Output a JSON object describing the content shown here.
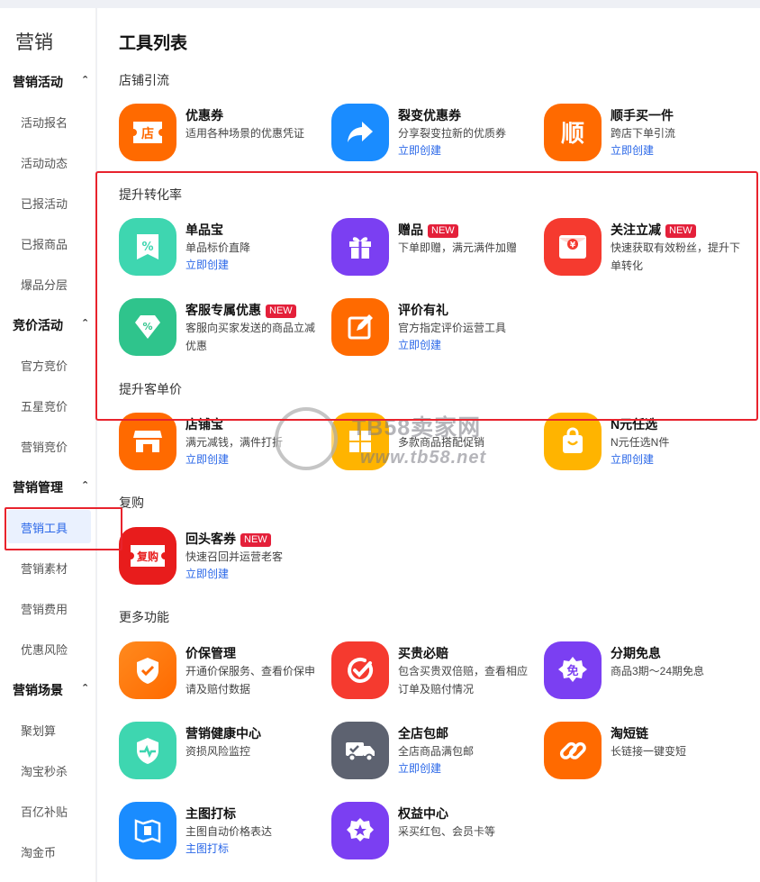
{
  "sidebar": {
    "title": "营销",
    "groups": [
      {
        "label": "营销活动",
        "items": [
          "活动报名",
          "活动动态",
          "已报活动",
          "已报商品",
          "爆品分层"
        ]
      },
      {
        "label": "竞价活动",
        "items": [
          "官方竞价",
          "五星竞价",
          "营销竞价"
        ]
      },
      {
        "label": "营销管理",
        "items": [
          "营销工具",
          "营销素材",
          "营销费用",
          "优惠风险"
        ]
      },
      {
        "label": "营销场景",
        "items": [
          "聚划算",
          "淘宝秒杀",
          "百亿补贴",
          "淘金币"
        ]
      }
    ],
    "active_item": "营销工具"
  },
  "main": {
    "title": "工具列表",
    "new_badge": "NEW",
    "create_link": "立即创建",
    "sections": [
      {
        "title": "店铺引流",
        "cards": [
          {
            "name": "优惠券",
            "desc": "适用各种场景的优惠凭证",
            "link": "",
            "icon": "shop-coupon-icon",
            "color": "#ff6a00",
            "icon_text": "店"
          },
          {
            "name": "裂变优惠券",
            "desc": "分享裂变拉新的优质券",
            "link": "立即创建",
            "icon": "share-arrow-icon",
            "color": "#1a8cff"
          },
          {
            "name": "顺手买一件",
            "desc": "跨店下单引流",
            "link": "立即创建",
            "icon": "shun-icon",
            "color": "#ff6a00",
            "icon_text": "顺"
          }
        ]
      },
      {
        "title": "提升转化率",
        "cards": [
          {
            "name": "单品宝",
            "desc": "单品标价直降",
            "link": "立即创建",
            "icon": "discount-tag-icon",
            "color": "#3ed6b0"
          },
          {
            "name": "赠品",
            "badge": "NEW",
            "desc": "下单即赠，满元满件加赠",
            "link": "",
            "icon": "gift-icon",
            "color": "#7b3ff2"
          },
          {
            "name": "关注立减",
            "badge": "NEW",
            "desc": "快速获取有效粉丝，提升下单转化",
            "link": "",
            "icon": "red-packet-icon",
            "color": "#f53a2f"
          },
          {
            "name": "客服专属优惠",
            "badge": "NEW",
            "desc": "客服向买家发送的商品立减优惠",
            "link": "",
            "icon": "service-discount-icon",
            "color": "#2fc48c"
          },
          {
            "name": "评价有礼",
            "desc": "官方指定评价运营工具",
            "link": "立即创建",
            "icon": "edit-review-icon",
            "color": "#ff6a00"
          }
        ]
      },
      {
        "title": "提升客单价",
        "cards": [
          {
            "name": "店铺宝",
            "desc": "满元减钱，满件打折",
            "link": "立即创建",
            "icon": "store-icon",
            "color": "#ff6a00"
          },
          {
            "name": "",
            "desc": "多款商品搭配促销",
            "link": "",
            "icon": "bundle-grid-icon",
            "color": "#ffb400"
          },
          {
            "name": "N元任选",
            "desc": "N元任选N件",
            "link": "立即创建",
            "icon": "shopping-bag-icon",
            "color": "#ffb400"
          }
        ]
      },
      {
        "title": "复购",
        "cards": [
          {
            "name": "回头客券",
            "badge": "NEW",
            "desc": "快速召回并运营老客",
            "link": "立即创建",
            "icon": "repurchase-coupon-icon",
            "color": "#e81c1c",
            "icon_text": "复购"
          }
        ]
      },
      {
        "title": "更多功能",
        "cards": [
          {
            "name": "价保管理",
            "desc": "开通价保服务、查看价保申请及赔付数据",
            "link": "",
            "icon": "price-shield-icon",
            "color": "#ff6a00"
          },
          {
            "name": "买贵必赔",
            "desc": "包含买贵双倍赔，查看相应订单及赔付情况",
            "link": "",
            "icon": "check-circle-icon",
            "color": "#f53a2f"
          },
          {
            "name": "分期免息",
            "desc": "商品3期～24期免息",
            "link": "",
            "icon": "interest-free-icon",
            "color": "#7b3ff2",
            "icon_text": "免"
          },
          {
            "name": "营销健康中心",
            "desc": "资损风险监控",
            "link": "",
            "icon": "health-shield-icon",
            "color": "#3ed6b0"
          },
          {
            "name": "全店包邮",
            "desc": "全店商品满包邮",
            "link": "立即创建",
            "icon": "delivery-truck-icon",
            "color": "#5d6270"
          },
          {
            "name": "淘短链",
            "desc": "长链接一键变短",
            "link": "",
            "icon": "link-icon",
            "color": "#ff6a00"
          },
          {
            "name": "主图打标",
            "desc": "主图自动价格表达",
            "link": "主图打标",
            "icon": "image-tag-icon",
            "color": "#1a8cff"
          },
          {
            "name": "权益中心",
            "desc": "采买红包、会员卡等",
            "link": "",
            "icon": "star-badge-icon",
            "color": "#7b3ff2"
          }
        ]
      }
    ]
  },
  "watermark": {
    "line1": "TB58卖家网",
    "line2": "www.tb58.net"
  }
}
